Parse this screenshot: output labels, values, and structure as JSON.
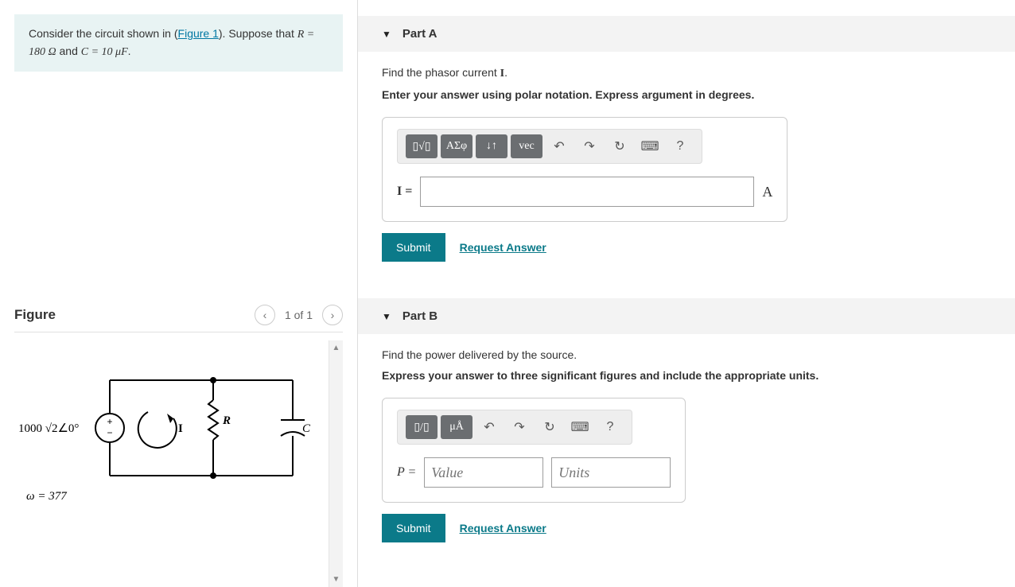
{
  "problem": {
    "prefix": "Consider the circuit shown in (",
    "figure_link": "Figure 1",
    "suffix": "). Suppose that ",
    "R_expr": "R = 180 Ω",
    "and_text": " and ",
    "C_expr": "C = 10 μF",
    "period": "."
  },
  "figure": {
    "title": "Figure",
    "counter": "1 of 1",
    "source_label": "1000 √2∠0°",
    "omega_label": "ω = 377",
    "I_label": "I",
    "R_label": "R",
    "C_label": "C"
  },
  "partA": {
    "title": "Part A",
    "prompt_prefix": "Find the phasor current ",
    "prompt_symbol": "I",
    "prompt_suffix": ".",
    "instruction": "Enter your answer using polar notation. Express argument in degrees.",
    "lhs": "I =",
    "rhs_unit": "A",
    "toolbar": {
      "templates": "▯√▯",
      "greek": "ΑΣφ",
      "arrows": "↓↑",
      "vec": "vec",
      "undo": "↶",
      "redo": "↷",
      "reset": "↻",
      "keyboard": "⌨",
      "help": "?"
    },
    "submit": "Submit",
    "request": "Request Answer"
  },
  "partB": {
    "title": "Part B",
    "prompt": "Find the power delivered by the source.",
    "instruction": "Express your answer to three significant figures and include the appropriate units.",
    "lhs": "P =",
    "value_placeholder": "Value",
    "units_placeholder": "Units",
    "toolbar": {
      "frac": "▯/▯",
      "units": "μÅ",
      "undo": "↶",
      "redo": "↷",
      "reset": "↻",
      "keyboard": "⌨",
      "help": "?"
    },
    "submit": "Submit",
    "request": "Request Answer"
  }
}
